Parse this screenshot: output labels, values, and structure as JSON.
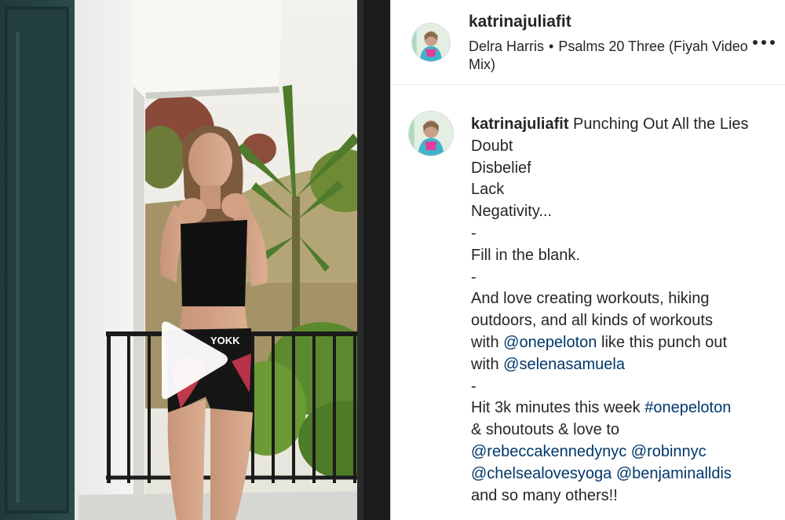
{
  "post": {
    "username": "katrinajuliafit",
    "audio_artist": "Delra Harris",
    "audio_separator": "•",
    "audio_track": "Psalms 20 Three (Fiyah Video Mix)",
    "more_icon": "more-horizontal-icon"
  },
  "video": {
    "play_icon": "play-icon"
  },
  "caption": {
    "username": "katrinajuliafit",
    "first_line_text": "Punching Out All the Lies",
    "lines": [
      "Doubt",
      "Disbelief",
      "Lack",
      "Negativity...",
      "-",
      "Fill in the blank.",
      "-",
      "And love creating workouts, hiking outdoors, and all kinds of workouts"
    ],
    "line_with_1": "with",
    "mention_onepeloton": "@onepeloton",
    "after_mention_1": "like this punch out",
    "line_with_2": "with",
    "mention_selena": "@selenasamuela",
    "dash_3": "-",
    "hit_text": "Hit 3k minutes this week",
    "hashtag_onepeloton": "#onepeloton",
    "shoutouts_text": "& shoutouts & love to",
    "mention_rebecca": "@rebeccakennedynyc",
    "mention_robin": "@robinnyc",
    "mention_chelsea": "@chelsealovesyoga",
    "mention_benjamin": "@benjaminalldis",
    "last_line": "and so many others!!"
  },
  "colors": {
    "text": "#262626",
    "link": "#00376b",
    "border": "#dbdbdb"
  }
}
